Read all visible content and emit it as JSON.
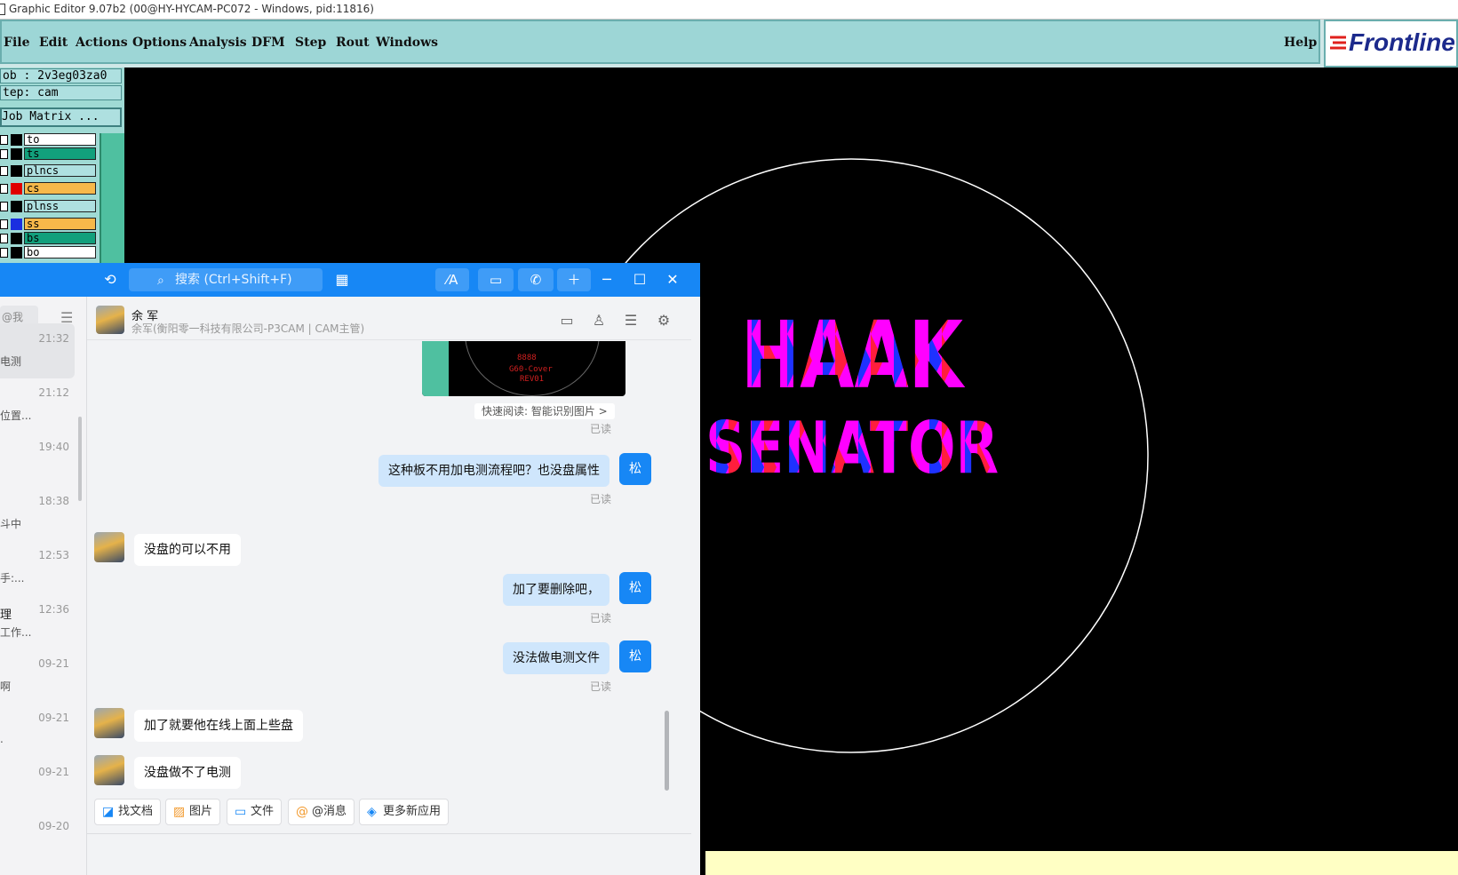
{
  "window": {
    "title": "Graphic Editor 9.07b2 (00@HY-HYCAM-PC072 - Windows, pid:11816)"
  },
  "menubar": {
    "items": [
      "File",
      "Edit",
      "Actions",
      "Options",
      "Analysis",
      "DFM",
      "Step",
      "Rout",
      "Windows"
    ],
    "help": "Help",
    "logo": "Frontline"
  },
  "left_panel": {
    "job": "ob : 2v3eg03za0",
    "step": "tep: cam",
    "job_matrix": "Job Matrix ...",
    "layers": [
      {
        "name": "to",
        "color": "#000000",
        "bg": "#ffffff"
      },
      {
        "name": "ts",
        "color": "#000000",
        "bg": "#12a07c"
      },
      {
        "name": "plncs",
        "color": "#000000",
        "bg": "#aee0e0"
      },
      {
        "name": "cs",
        "color": "#e00000",
        "bg": "#f7b84a"
      },
      {
        "name": "plnss",
        "color": "#000000",
        "bg": "#aee0e0"
      },
      {
        "name": "ss",
        "color": "#1a2ee0",
        "bg": "#f7b84a"
      },
      {
        "name": "bs",
        "color": "#000000",
        "bg": "#12a07c"
      },
      {
        "name": "bo",
        "color": "#000000",
        "bg": "#ffffff"
      }
    ]
  },
  "canvas": {
    "text_line1": "HAAK",
    "text_line2": "SENATOR",
    "colors": {
      "fill": "#ff00ff",
      "accent_red": "#ff1e3c",
      "accent_blue": "#1e32ff",
      "outline": "#ffffff"
    }
  },
  "chat": {
    "search_placeholder": "搜索 (Ctrl+Shift+F)",
    "sidebar": {
      "at_me": "@我",
      "conversations": [
        {
          "time": "21:32",
          "preview": "电测",
          "selected": true
        },
        {
          "time": "21:12",
          "preview": "位置..."
        },
        {
          "time": "19:40",
          "preview": ""
        },
        {
          "time": "18:38",
          "preview": "斗中"
        },
        {
          "time": "12:53",
          "preview": "手:..."
        },
        {
          "time": "12:36",
          "name": "理",
          "preview": "工作..."
        },
        {
          "time": "09-21",
          "preview": "啊"
        },
        {
          "time": "09-21",
          "preview": "."
        },
        {
          "time": "09-21",
          "preview": ""
        },
        {
          "time": "09-20",
          "preview": ""
        }
      ]
    },
    "header": {
      "name": "余 军",
      "subtitle": "余军(衡阳零一科技有限公司-P3CAM | CAM主管)"
    },
    "image_message": {
      "lines": [
        "8888",
        "G60-Cover",
        "REV01"
      ]
    },
    "quick_read": "快速阅读: 智能识别图片 >",
    "read_label": "已读",
    "me_avatar": "松",
    "messages": [
      {
        "from": "me",
        "text": "这种板不用加电测流程吧？也没盘属性"
      },
      {
        "from": "them",
        "text": "没盘的可以不用"
      },
      {
        "from": "me",
        "text": "加了要删除吧，"
      },
      {
        "from": "me",
        "text": "没法做电测文件"
      },
      {
        "from": "them",
        "text": "加了就要他在线上面上些盘"
      },
      {
        "from": "them",
        "text": "没盘做不了电测"
      }
    ],
    "toolbar": [
      "找文档",
      "图片",
      "文件",
      "@消息",
      "更多新应用"
    ]
  }
}
